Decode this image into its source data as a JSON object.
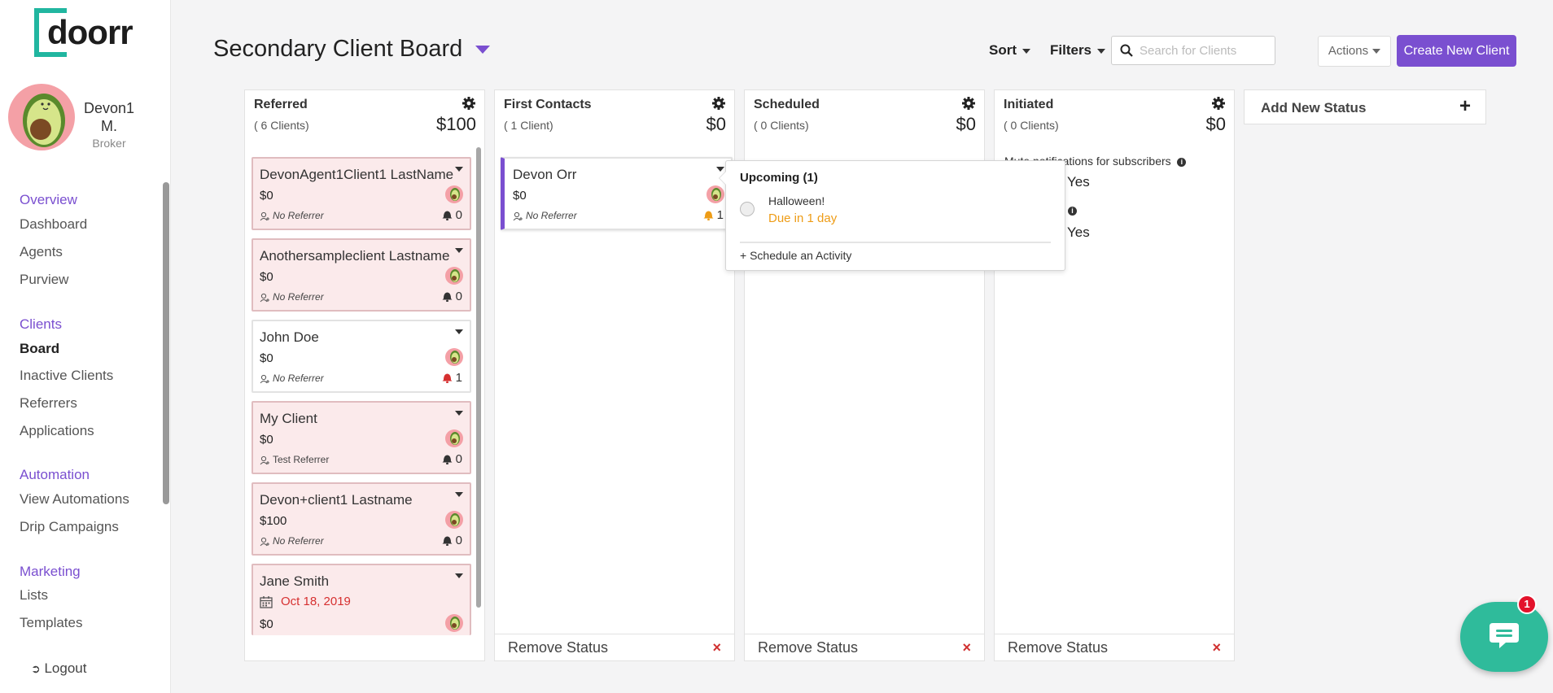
{
  "sidebar": {
    "logo_text": "doorr",
    "user_name": "Devon1 M.",
    "user_role": "Broker",
    "sections": [
      {
        "label": "Overview",
        "items": [
          "Dashboard",
          "Agents",
          "Purview"
        ]
      },
      {
        "label": "Clients",
        "items": [
          "Board",
          "Inactive Clients",
          "Referrers",
          "Applications"
        ]
      },
      {
        "label": "Automation",
        "items": [
          "View Automations",
          "Drip Campaigns"
        ]
      },
      {
        "label": "Marketing",
        "items": [
          "Lists",
          "Templates"
        ]
      }
    ],
    "active_item": "Board",
    "logout": "Logout"
  },
  "header": {
    "title": "Secondary Client Board",
    "sort": "Sort",
    "filters": "Filters",
    "search_placeholder": "Search for Clients",
    "actions": "Actions",
    "create": "Create New Client"
  },
  "columns": [
    {
      "name": "Referred",
      "count": "( 6 Clients)",
      "amount": "$100"
    },
    {
      "name": "First Contacts",
      "count": "( 1 Client)",
      "amount": "$0"
    },
    {
      "name": "Scheduled",
      "count": "( 0 Clients)",
      "amount": "$0"
    },
    {
      "name": "Initiated",
      "count": "( 0 Clients)",
      "amount": "$0"
    }
  ],
  "remove_status": "Remove Status",
  "add_status": "Add New Status",
  "cards_referred": [
    {
      "name": "DevonAgent1Client1 LastName",
      "amount": "$0",
      "referrer": "No Referrer",
      "alerts": "0"
    },
    {
      "name": "Anothersampleclient Lastname",
      "amount": "$0",
      "referrer": "No Referrer",
      "alerts": "0"
    },
    {
      "name": "John Doe",
      "amount": "$0",
      "referrer": "No Referrer",
      "alerts": "1"
    },
    {
      "name": "My Client",
      "amount": "$0",
      "referrer": "Test Referrer",
      "alerts": "0"
    },
    {
      "name": "Devon+client1 Lastname",
      "amount": "$100",
      "referrer": "No Referrer",
      "alerts": "0"
    },
    {
      "name": "Jane Smith",
      "date": "Oct 18, 2019",
      "amount": "$0"
    }
  ],
  "cards_first_contacts": [
    {
      "name": "Devon Orr",
      "amount": "$0",
      "referrer": "No Referrer",
      "alerts": "1"
    }
  ],
  "popup": {
    "heading": "Upcoming (1)",
    "activity": "Halloween!",
    "due": "Due in 1 day",
    "schedule_link": "+ Schedule an Activity"
  },
  "initiated": {
    "mute_text": "Mute notifications for subscribers",
    "yes1": "Yes",
    "yes2": "Yes"
  },
  "chat_badge": "1"
}
